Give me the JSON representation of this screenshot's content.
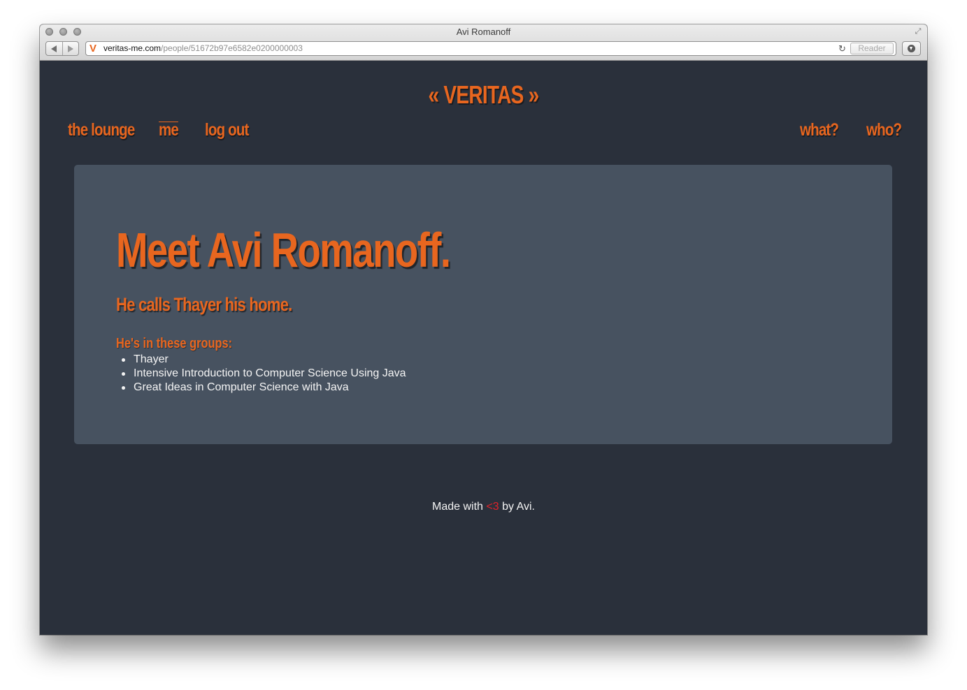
{
  "browser": {
    "window_title": "Avi Romanoff",
    "url_domain": "veritas-me.com",
    "url_path": "/people/51672b97e6582e0200000003",
    "favicon_letter": "V",
    "reader_label": "Reader",
    "reload_icon": "↻",
    "fullscreen_icon": "⤢"
  },
  "site": {
    "logo": "« VERITAS »",
    "nav_left": [
      "the lounge",
      "me",
      "log out"
    ],
    "nav_right": [
      "what?",
      "who?"
    ],
    "accent_color": "#e8661f"
  },
  "profile": {
    "title": "Meet Avi Romanoff.",
    "home": "He calls Thayer his home.",
    "groups_heading": "He's in these groups:",
    "groups": [
      "Thayer",
      "Intensive Introduction to Computer Science Using Java",
      "Great Ideas in Computer Science with Java"
    ]
  },
  "footer": {
    "prefix": "Made with",
    "heart": "<3",
    "suffix": "by Avi."
  }
}
